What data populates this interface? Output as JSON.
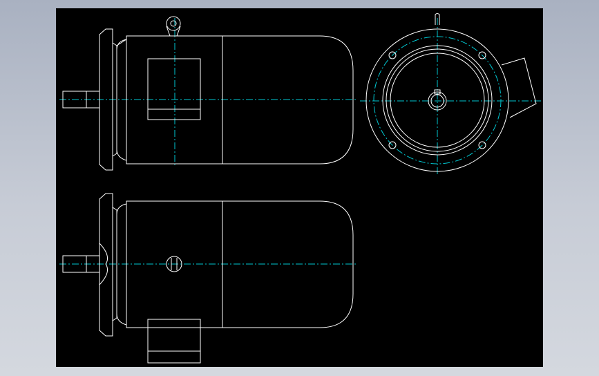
{
  "colors": {
    "viewport_background": "#000000",
    "outline": "#ffffff",
    "centerline": "#00c8d2",
    "window_background": "#b4bbc8"
  },
  "drawing": {
    "views": [
      "side-view-top",
      "end-view",
      "side-view-bottom"
    ]
  }
}
